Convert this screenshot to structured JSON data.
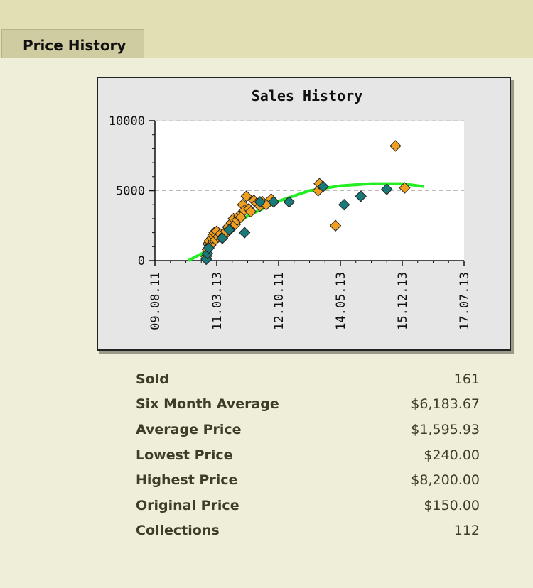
{
  "section_tab": "Price History",
  "chart_data": {
    "type": "scatter",
    "title": "Sales History",
    "xlabel": "",
    "ylabel": "",
    "x_ticks": [
      "09.08.11",
      "11.03.13",
      "12.10.11",
      "14.05.13",
      "15.12.13",
      "17.07.13"
    ],
    "x_range": [
      0,
      5
    ],
    "y_ticks": [
      "0",
      "5000",
      "10000"
    ],
    "ylim": [
      0,
      10000
    ],
    "grid": "horizontal dashed",
    "colors": {
      "orange": "#f0a020",
      "teal": "#1a7a7a",
      "trend": "#22ee22",
      "plot_bg": "#ffffff"
    },
    "series": [
      {
        "color": "orange",
        "points": [
          [
            0.83,
            300
          ],
          [
            0.85,
            800
          ],
          [
            0.86,
            1200
          ],
          [
            0.88,
            1400
          ],
          [
            0.9,
            1100
          ],
          [
            0.92,
            1600
          ],
          [
            0.94,
            1800
          ],
          [
            0.96,
            2000
          ],
          [
            0.98,
            1500
          ],
          [
            1.0,
            2100
          ],
          [
            1.03,
            1700
          ],
          [
            1.06,
            1900
          ],
          [
            1.09,
            1600
          ],
          [
            1.12,
            1800
          ],
          [
            1.15,
            2100
          ],
          [
            1.18,
            2400
          ],
          [
            1.21,
            2200
          ],
          [
            1.24,
            2700
          ],
          [
            1.27,
            3000
          ],
          [
            1.3,
            2600
          ],
          [
            1.33,
            2900
          ],
          [
            1.36,
            3200
          ],
          [
            1.39,
            3100
          ],
          [
            1.42,
            4000
          ],
          [
            1.45,
            3600
          ],
          [
            1.48,
            4600
          ],
          [
            1.52,
            3700
          ],
          [
            1.55,
            3500
          ],
          [
            1.6,
            4300
          ],
          [
            1.65,
            4100
          ],
          [
            1.7,
            3900
          ],
          [
            1.74,
            4200
          ],
          [
            1.8,
            4000
          ],
          [
            1.88,
            4400
          ],
          [
            2.64,
            5000
          ],
          [
            2.66,
            5500
          ],
          [
            2.92,
            2500
          ],
          [
            3.89,
            8200
          ],
          [
            4.04,
            5200
          ]
        ]
      },
      {
        "color": "teal",
        "points": [
          [
            0.83,
            100
          ],
          [
            0.85,
            500
          ],
          [
            0.87,
            900
          ],
          [
            1.09,
            1600
          ],
          [
            1.2,
            2200
          ],
          [
            1.45,
            2000
          ],
          [
            1.7,
            4200
          ],
          [
            1.92,
            4200
          ],
          [
            2.17,
            4200
          ],
          [
            2.72,
            5300
          ],
          [
            3.06,
            4000
          ],
          [
            3.33,
            4600
          ],
          [
            3.75,
            5100
          ]
        ]
      },
      {
        "color": "trend",
        "line": [
          [
            0.54,
            0
          ],
          [
            0.8,
            600
          ],
          [
            1.1,
            1900
          ],
          [
            1.5,
            3200
          ],
          [
            2.0,
            4250
          ],
          [
            2.5,
            5000
          ],
          [
            3.0,
            5350
          ],
          [
            3.5,
            5500
          ],
          [
            4.0,
            5500
          ],
          [
            4.35,
            5300
          ]
        ]
      }
    ]
  },
  "stats": [
    {
      "label": "Sold",
      "value": "161"
    },
    {
      "label": "Six Month Average",
      "value": "$6,183.67"
    },
    {
      "label": "Average Price",
      "value": "$1,595.93"
    },
    {
      "label": "Lowest Price",
      "value": "$240.00"
    },
    {
      "label": "Highest Price",
      "value": "$8,200.00"
    },
    {
      "label": "Original Price",
      "value": "$150.00"
    },
    {
      "label": "Collections",
      "value": "112"
    }
  ]
}
